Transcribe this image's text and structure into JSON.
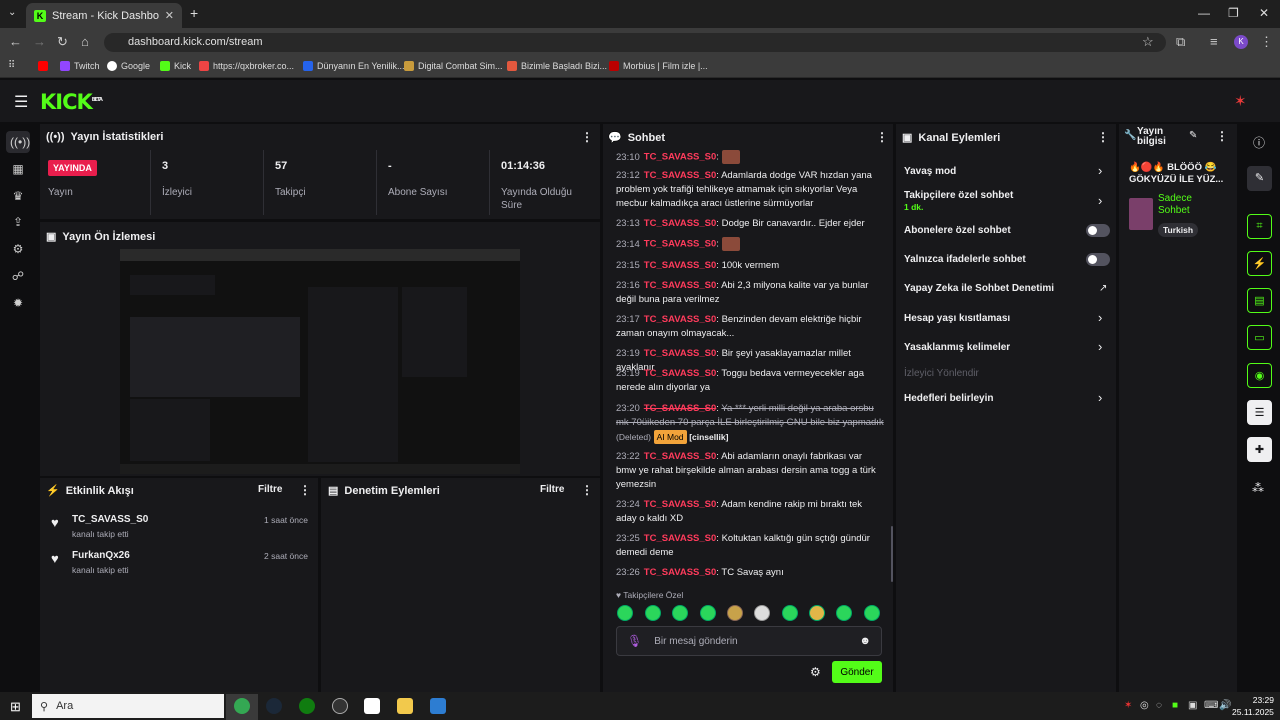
{
  "browser": {
    "tab_title": "Stream - Kick Dashboard",
    "url": "dashboard.kick.com/stream",
    "bookmarks": [
      "Twitch",
      "Google",
      "Kick",
      "https://qxbroker.co...",
      "Dünyanın En Yenilik...",
      "Digital Combat Sim...",
      "Bizimle Başladı Bizi...",
      "Morbius | Film izle |..."
    ],
    "profile_initial": "K"
  },
  "app": {
    "logo": "KICK",
    "logo_sup": "BETA"
  },
  "stats": {
    "title": "Yayın İstatistikleri",
    "live_badge": "YAYINDA",
    "live_label": "Yayın",
    "viewers_value": "3",
    "viewers_label": "İzleyici",
    "followers_value": "57",
    "followers_label": "Takipçi",
    "subs_value": "-",
    "subs_label": "Abone Sayısı",
    "uptime_value": "01:14:36",
    "uptime_label": "Yayında Olduğu Süre"
  },
  "preview": {
    "title": "Yayın Ön İzlemesi"
  },
  "activity": {
    "title": "Etkinlik Akışı",
    "filter": "Filtre",
    "items": [
      {
        "user": "TC_SAVASS_S0",
        "action": "kanalı takip etti",
        "time": "1 saat önce"
      },
      {
        "user": "FurkanQx26",
        "action": "kanalı takip etti",
        "time": "2 saat önce"
      }
    ]
  },
  "moderation": {
    "title": "Denetim Eylemleri",
    "filter": "Filtre"
  },
  "chat": {
    "title": "Sohbet",
    "messages": [
      {
        "time": "23:10",
        "user": "TC_SAVASS_S0",
        "text": ""
      },
      {
        "time": "23:12",
        "user": "TC_SAVASS_S0",
        "text": "Adamlarda dodge VAR hızdan yana problem yok trafiği tehlikeye atmamak için sıkıyorlar Veya mecbur kalmadıkça aracı üstlerine sürmüyorlar"
      },
      {
        "time": "23:13",
        "user": "TC_SAVASS_S0",
        "text": "Dodge Bir canavardır.. Ejder ejder"
      },
      {
        "time": "23:14",
        "user": "TC_SAVASS_S0",
        "text": ""
      },
      {
        "time": "23:15",
        "user": "TC_SAVASS_S0",
        "text": "100k vermem"
      },
      {
        "time": "23:16",
        "user": "TC_SAVASS_S0",
        "text": "Abi 2,3 milyona kalite var ya bunlar değil buna para verilmez"
      },
      {
        "time": "23:17",
        "user": "TC_SAVASS_S0",
        "text": "Benzinden devam elektriğe hiçbir zaman onayım olmayacak..."
      },
      {
        "time": "23:19",
        "user": "TC_SAVASS_S0",
        "text": "Bir şeyi yasaklayamazlar millet ayaklanır"
      },
      {
        "time": "23:19",
        "user": "TC_SAVASS_S0",
        "text": "Toggu bedava vermeyecekler aga nerede alın diyorlar ya"
      },
      {
        "time": "23:20",
        "user": "TC_SAVASS_S0",
        "text": "Ya *** yerli milli değil ya araba orsbu mk 70üikeden 70 parça İLE birleştirilmiş GNU bile biz yapmadık",
        "deleted": "(Deleted)",
        "badge": "AI Mod",
        "tag": "[cinsellik]"
      },
      {
        "time": "23:22",
        "user": "TC_SAVASS_S0",
        "text": "Abi adamların onaylı fabrikası var bmw ye rahat birşekilde alman arabası dersin ama togg a türk yemezsin"
      },
      {
        "time": "23:24",
        "user": "TC_SAVASS_S0",
        "text": "Adam kendine rakip mi bıraktı tek aday o kaldı XD"
      },
      {
        "time": "23:25",
        "user": "TC_SAVASS_S0",
        "text": "Koltuktan kalktığı gün sçtığı gündür demedi deme"
      },
      {
        "time": "23:26",
        "user": "TC_SAVASS_S0",
        "text": "TC Savaş aynı"
      }
    ],
    "followers_only": "Takipçilere Özel",
    "input_placeholder": "Bir mesaj gönderin",
    "send_label": "Gönder"
  },
  "channel_actions": {
    "title": "Kanal Eylemleri",
    "slow_mode": "Yavaş mod",
    "followers_chat": "Takipçilere özel sohbet",
    "followers_chat_value": "1 dk.",
    "subs_chat": "Abonelere özel sohbet",
    "emote_chat": "Yalnızca ifadelerle sohbet",
    "ai_mod": "Yapay Zeka ile Sohbet Denetimi",
    "age_restrict": "Hesap yaşı kısıtlaması",
    "banned_words": "Yasaklanmış kelimeler",
    "viewer_redirect": "İzleyici Yönlendir",
    "goals": "Hedefleri belirleyin"
  },
  "stream_info": {
    "title": "Yayın bilgisi",
    "stream_title": "🔥🔴🔥 BLÖÖÖ 😂 GÖKYÜZÜ İLE YÜZ...",
    "category": "Sadece Sohbet",
    "language": "Turkish"
  },
  "taskbar": {
    "search": "Ara",
    "time": "23:29",
    "date": "25.11.2025"
  }
}
